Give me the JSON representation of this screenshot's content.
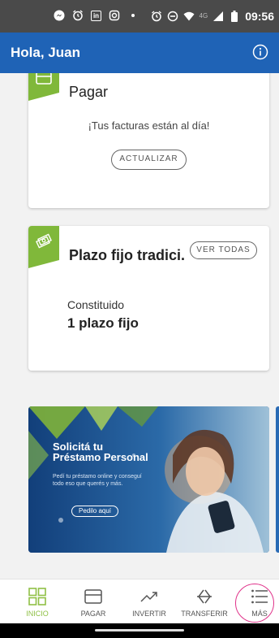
{
  "status_bar": {
    "clock": "09:56",
    "network_label": "4G",
    "linkedin_label": "in"
  },
  "header": {
    "greeting": "Hola, Juan"
  },
  "cards": {
    "pay": {
      "title": "Pagar",
      "message": "¡Tus facturas están al día!",
      "button": "ACTUALIZAR"
    },
    "fixed_term": {
      "title": "Plazo fijo tradici...",
      "button": "VER TODAS",
      "label": "Constituido",
      "value": "1 plazo fijo"
    }
  },
  "banner": {
    "title_line1": "Solicitá tu",
    "title_line2": "Préstamo Personal",
    "subtitle": "Pedí tu préstamo online y conseguí todo eso que querés y más.",
    "button": "Pedilo aquí"
  },
  "bottom_nav": {
    "items": [
      {
        "label": "INICIO",
        "icon": "grid-icon"
      },
      {
        "label": "PAGAR",
        "icon": "card-icon"
      },
      {
        "label": "INVERTIR",
        "icon": "trend-up-icon"
      },
      {
        "label": "TRANSFERIR",
        "icon": "transfer-arrows-icon"
      },
      {
        "label": "MÁS",
        "icon": "menu-list-icon"
      }
    ]
  },
  "colors": {
    "brand_blue": "#1f63b6",
    "accent_green": "#80b83a",
    "highlight_ring": "#e0338a"
  }
}
